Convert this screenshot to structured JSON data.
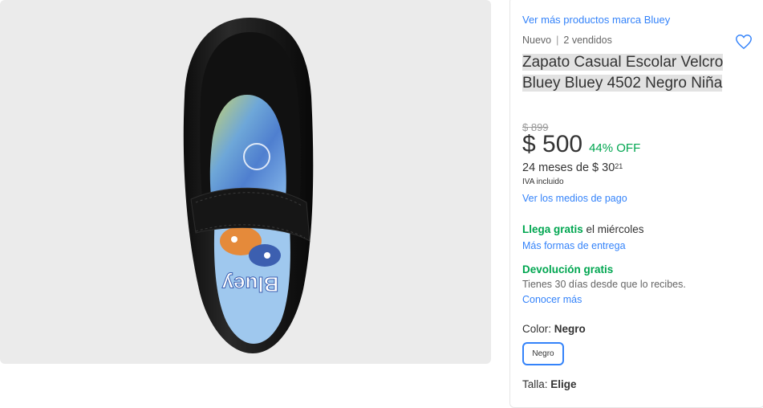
{
  "gallery": {
    "image_alt": "Zapato negro escolar con plantilla Bluey",
    "insole_text": "Bluey"
  },
  "details": {
    "brand_link": "Ver más productos marca Bluey",
    "condition": "Nuevo",
    "sold": "2 vendidos",
    "title": "Zapato Casual Escolar Velcro Bluey Bluey 4502 Negro Niña",
    "favorite_icon": "heart-icon",
    "price": {
      "original": "$ 899",
      "current": "$ 500",
      "discount": "44% OFF",
      "installments_prefix": "24 meses de $ 30",
      "installments_cents": "21",
      "tax_note": "IVA incluido",
      "payment_link": "Ver los medios de pago"
    },
    "shipping": {
      "free_label": "Llega gratis",
      "day": " el miércoles",
      "more_link": "Más formas de entrega"
    },
    "returns": {
      "label": "Devolución gratis",
      "description": "Tienes 30 días desde que lo recibes.",
      "link": "Conocer más"
    },
    "color": {
      "label": "Color: ",
      "selected": "Negro",
      "options": [
        "Negro"
      ]
    },
    "size": {
      "label": "Talla: ",
      "selected": "Elige"
    }
  },
  "colors": {
    "accent": "#3483fa",
    "green": "#00a650",
    "gallery_bg": "#ebebeb"
  }
}
